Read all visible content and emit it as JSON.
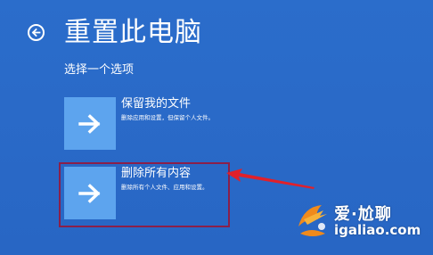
{
  "header": {
    "back_icon": "back-arrow-circle-icon",
    "title": "重置此电脑"
  },
  "prompt": "选择一个选项",
  "options": [
    {
      "icon": "arrow-right-icon",
      "title": "保留我的文件",
      "description": "删除应用和设置，但保留个人文件。"
    },
    {
      "icon": "arrow-right-icon",
      "title": "删除所有内容",
      "description": "删除所有个人文件、应用和设置。"
    }
  ],
  "annotation": {
    "highlight_color": "#8a1f4a",
    "arrow_color": "#e0202a"
  },
  "watermark": {
    "brand": "爱·尬聊",
    "domain": "igaliao.com"
  },
  "colors": {
    "background": "#2a6ac8",
    "tile": "#5da4ee",
    "text": "#ffffff"
  }
}
